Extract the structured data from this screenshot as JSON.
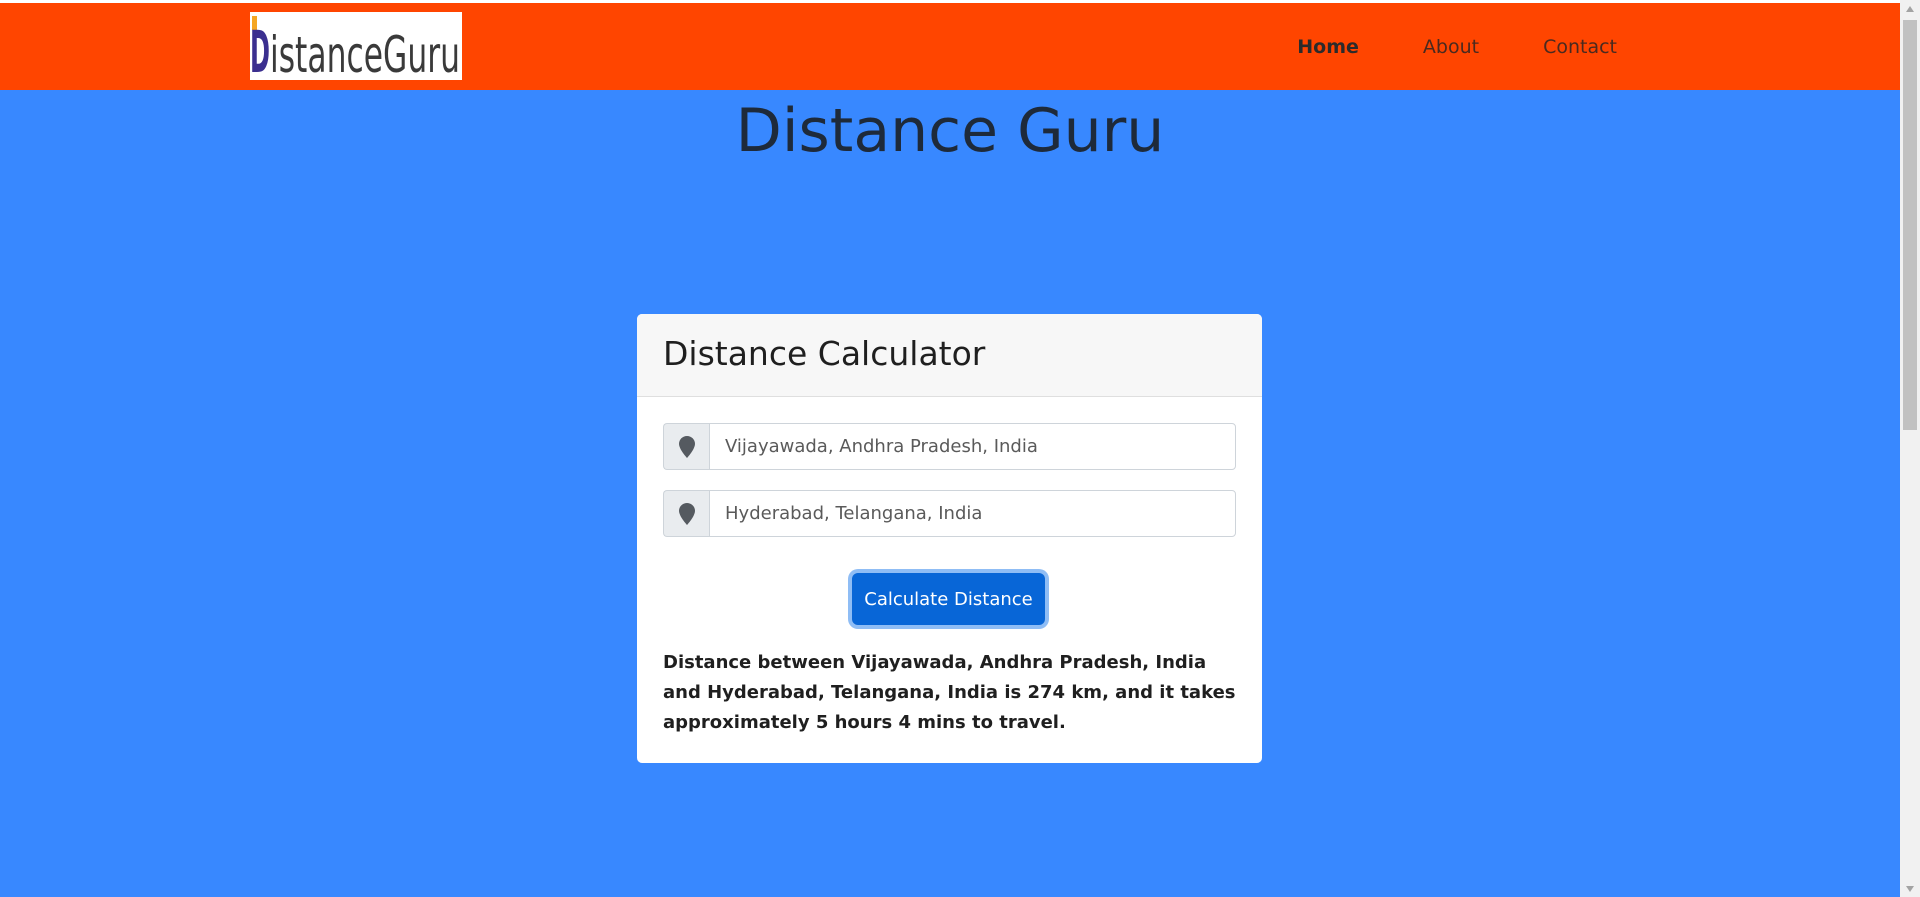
{
  "brand": {
    "logo_text": "DistanceGuru",
    "colors": {
      "navbar": "#ff4500",
      "page_background": "#3888ff",
      "primary_button": "#0866d7"
    }
  },
  "nav": {
    "items": [
      {
        "label": "Home",
        "active": true
      },
      {
        "label": "About",
        "active": false
      },
      {
        "label": "Contact",
        "active": false
      }
    ]
  },
  "hero": {
    "title": "Distance Guru"
  },
  "calculator": {
    "title": "Distance Calculator",
    "origin": {
      "value": "Vijayawada, Andhra Pradesh, India",
      "icon": "map-marker-icon"
    },
    "destination": {
      "value": "Hyderabad, Telangana, India",
      "icon": "map-marker-icon"
    },
    "button_label": "Calculate Distance",
    "result_text": "Distance between Vijayawada, Andhra Pradesh, India and Hyderabad, Telangana, India is 274 km, and it takes approximately 5 hours 4 mins to travel."
  }
}
